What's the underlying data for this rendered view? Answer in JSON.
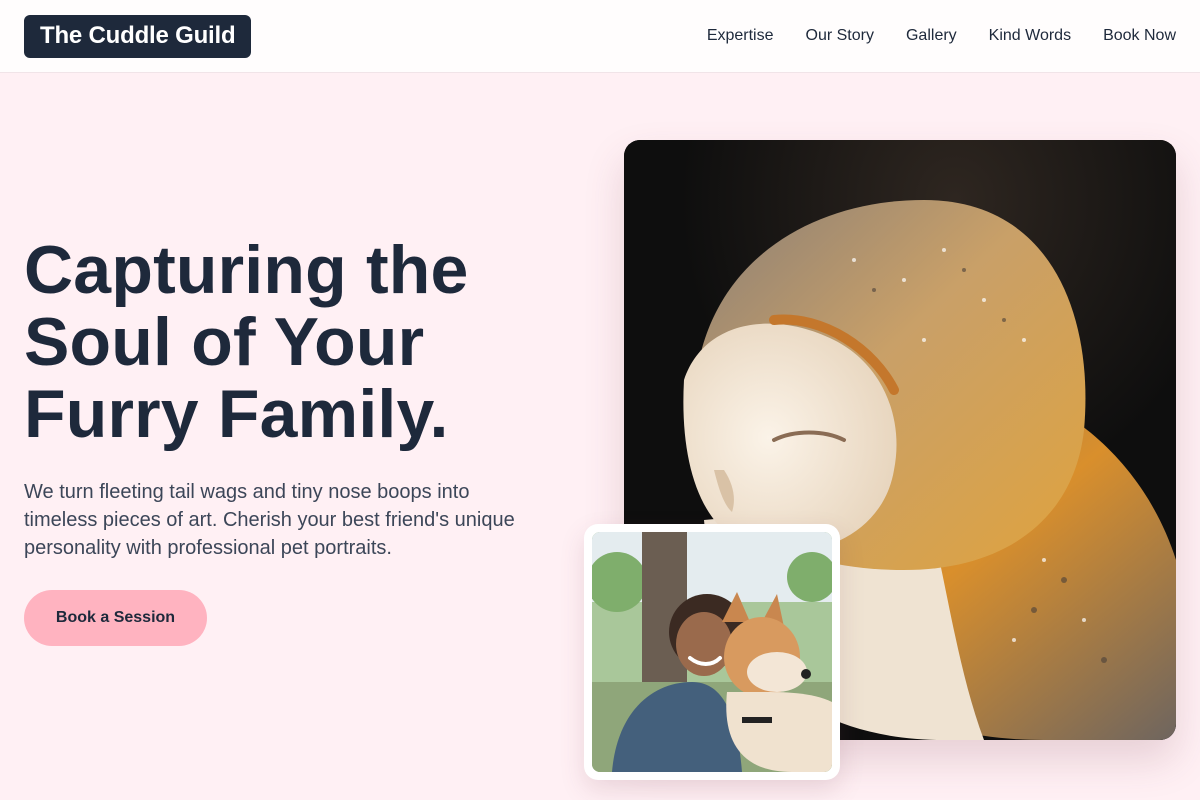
{
  "brand": {
    "name": "The Cuddle Guild"
  },
  "nav": {
    "items": [
      {
        "label": "Expertise"
      },
      {
        "label": "Our Story"
      },
      {
        "label": "Gallery"
      },
      {
        "label": "Kind Words"
      },
      {
        "label": "Book Now"
      }
    ]
  },
  "hero": {
    "title_line1": "Capturing the",
    "title_line2": "Soul of Your",
    "title_line3": "Furry Family.",
    "subtitle": "We turn fleeting tail wags and tiny nose boops into timeless pieces of art. Cherish your best friend's unique personality with professional pet portraits.",
    "cta_label": "Book a Session"
  },
  "colors": {
    "background": "#fff0f4",
    "dark": "#1e293b",
    "accent": "#ffb3c0"
  }
}
